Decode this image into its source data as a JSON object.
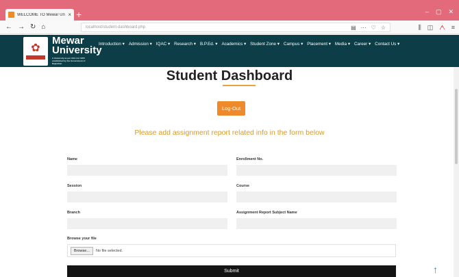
{
  "browser": {
    "tab_title": "WELCOME TO Mewar Univers",
    "tab_close": "×",
    "new_tab": "+",
    "url": "localhost/student-dashboard.php",
    "window_controls": [
      "–",
      "▢",
      "✕"
    ]
  },
  "site": {
    "brand_line1": "Mewar",
    "brand_line2": "University",
    "brand_tagline": "A University as per UGC Act 1956 established by the Government of Rajasthan",
    "nav": [
      "Introduction ▾",
      "Admission ▾",
      "IQAC ▾",
      "Research ▾",
      "B.P.Ed. ▾",
      "Academics ▾",
      "Student Zone ▾",
      "Campus ▾",
      "Placement ▾",
      "Media ▾",
      "Career ▾",
      "Contact Us ▾"
    ]
  },
  "page": {
    "title_part1": "Student ",
    "title_part2": "Dashboard",
    "logout_label": "Log-Out",
    "form_heading": "Please add assignment report related info in the form below"
  },
  "form": {
    "name_label": "Name",
    "enrollment_label": "Enrollment No.",
    "session_label": "Session",
    "course_label": "Course",
    "branch_label": "Branch",
    "subject_label": "Assignment Report Subject Name",
    "file_label": "Browse your file",
    "browse_button": "Browse...",
    "file_status": "No file selected.",
    "submit_label": "Submit"
  },
  "colors": {
    "header_bg": "#0d3d47",
    "accent_orange": "#ee8a2a",
    "heading_gold": "#d99a26",
    "submit_bg": "#141414"
  }
}
